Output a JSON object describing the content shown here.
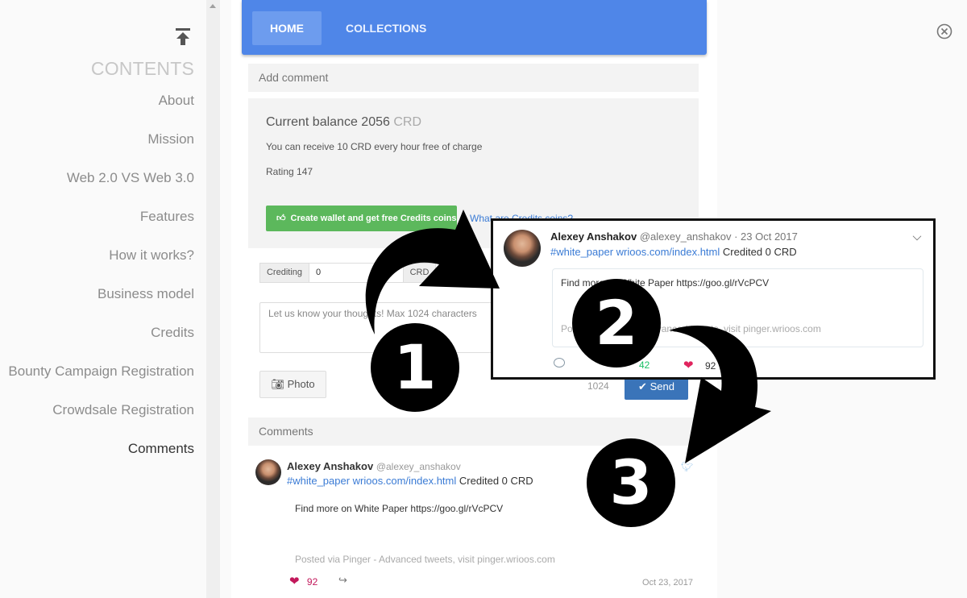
{
  "sidebar": {
    "contents_title": "CONTENTS",
    "items": [
      {
        "label": "About"
      },
      {
        "label": "Mission"
      },
      {
        "label": "Web 2.0 VS Web 3.0"
      },
      {
        "label": "Features"
      },
      {
        "label": "How it works?"
      },
      {
        "label": "Business model"
      },
      {
        "label": "Credits"
      },
      {
        "label": "Bounty Campaign Registration"
      },
      {
        "label": "Crowdsale Registration"
      },
      {
        "label": "Comments"
      }
    ],
    "active_item": "Comments"
  },
  "tabs": [
    {
      "label": "HOME",
      "active": true
    },
    {
      "label": "COLLECTIONS",
      "active": false
    }
  ],
  "add_comment": {
    "title": "Add comment"
  },
  "balance": {
    "label": "Current balance 2056",
    "unit": "CRD",
    "free_text": "You can receive 10 CRD every hour free of charge",
    "rating": "Rating 147",
    "wallet_button": "Create wallet and get free Credits coins",
    "what_link": "What are Credits coins?"
  },
  "crediting": {
    "label": "Crediting",
    "value": "0",
    "unit": "CRD"
  },
  "comment_form": {
    "placeholder": "Let us know your thoughts! Max 1024 characters",
    "photo": "Photo",
    "char_count": "1024",
    "send": "Send"
  },
  "comments_header": "Comments",
  "comment": {
    "name": "Alexey Anshakov",
    "handle": "@alexey_anshakov",
    "link": "#white_paper wrioos.com/index.html",
    "credited": "Credited 0 CRD",
    "body": "Find more on White Paper https://goo.gl/rVcPCV",
    "posted": "Posted via Pinger - Advanced tweets, visit pinger.wrioos.com",
    "likes": "92",
    "date": "Oct 23, 2017"
  },
  "tweet_card": {
    "name": "Alexey Anshakov",
    "handle": "@alexey_anshakov",
    "date": "· 23 Oct 2017",
    "link": "#white_paper wrioos.com/index.html",
    "credited": "Credited 0 CRD",
    "body": "Find more on White Paper https://goo.gl/rVcPCV",
    "posted": "Posted via Pinger - Advanced tweets, visit pinger.wrioos.com",
    "retweets": "42",
    "likes": "92"
  },
  "badges": [
    "1",
    "2",
    "3"
  ],
  "colors": {
    "tab_bar": "#4f86e8",
    "wallet_button": "#5cb85c",
    "send_button": "#3a74b9",
    "like": "#e0245e",
    "link": "#3a7bd5"
  }
}
